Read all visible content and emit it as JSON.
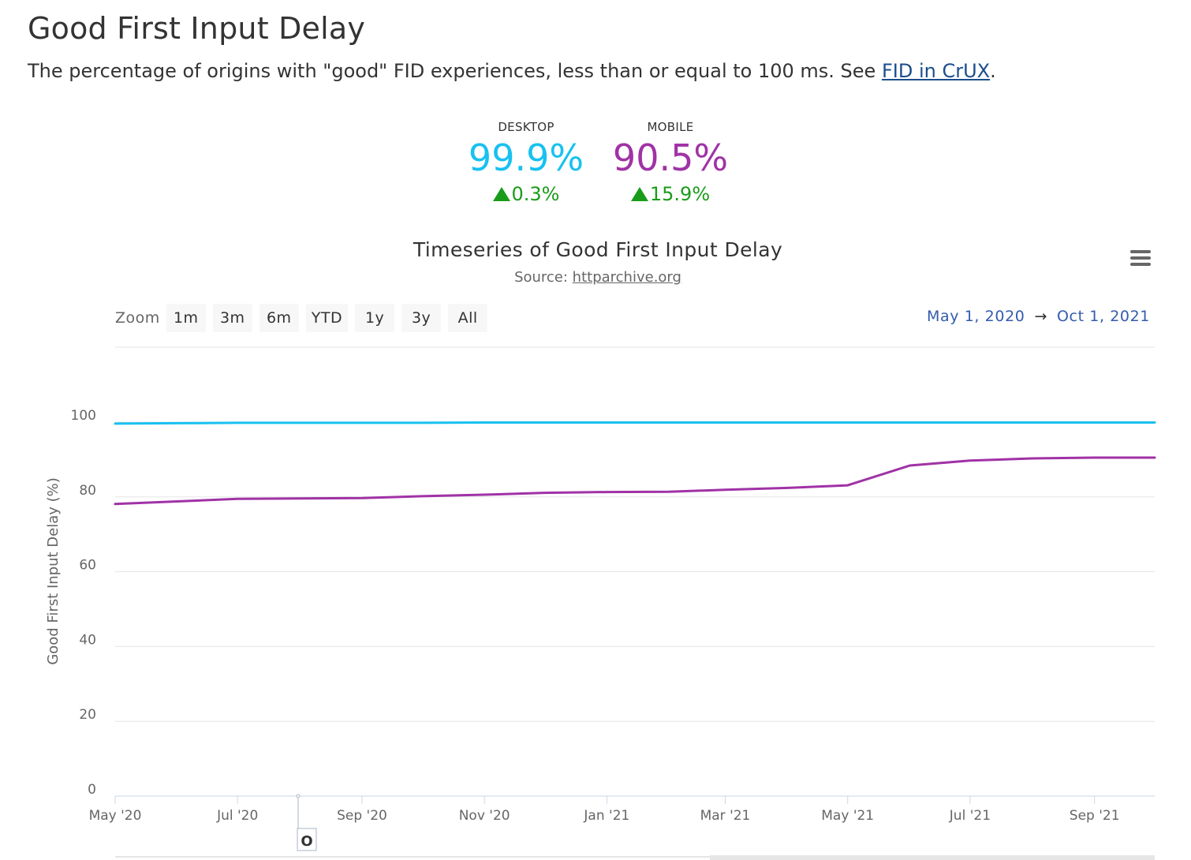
{
  "header": {
    "title": "Good First Input Delay",
    "description_prefix": "The percentage of origins with \"good\" FID experiences, less than or equal to 100 ms. See ",
    "description_link": "FID in CrUX",
    "description_suffix": "."
  },
  "kpis": {
    "desktop": {
      "label": "DESKTOP",
      "value": "99.9%",
      "change": "0.3%",
      "color": "#18c1f0"
    },
    "mobile": {
      "label": "MOBILE",
      "value": "90.5%",
      "change": "15.9%",
      "color": "#a032a6"
    }
  },
  "chart": {
    "title": "Timeseries of Good First Input Delay",
    "subtitle_prefix": "Source: ",
    "subtitle_link": "httparchive.org",
    "menu_icon": "hamburger-menu-icon",
    "zoom": {
      "label": "Zoom",
      "buttons": [
        "1m",
        "3m",
        "6m",
        "YTD",
        "1y",
        "3y",
        "All"
      ]
    },
    "range": {
      "from": "May 1, 2020",
      "arrow": "→",
      "to": "Oct 1, 2021"
    },
    "navigator_handle_label": "O"
  },
  "chart_data": {
    "type": "line",
    "title": "Timeseries of Good First Input Delay",
    "xlabel": "",
    "ylabel": "Good First Input Delay (%)",
    "ylim": [
      0,
      100
    ],
    "yticks": [
      0,
      20,
      40,
      60,
      80,
      100
    ],
    "xlim": [
      "2020-05-01",
      "2021-10-01"
    ],
    "xticks": [
      {
        "date": "2020-05-01",
        "label": "May '20"
      },
      {
        "date": "2020-07-01",
        "label": "Jul '20"
      },
      {
        "date": "2020-09-01",
        "label": "Sep '20"
      },
      {
        "date": "2020-11-01",
        "label": "Nov '20"
      },
      {
        "date": "2021-01-01",
        "label": "Jan '21"
      },
      {
        "date": "2021-03-01",
        "label": "Mar '21"
      },
      {
        "date": "2021-05-01",
        "label": "May '21"
      },
      {
        "date": "2021-07-01",
        "label": "Jul '21"
      },
      {
        "date": "2021-09-01",
        "label": "Sep '21"
      }
    ],
    "grid": true,
    "x": [
      "2020-05-01",
      "2020-06-01",
      "2020-07-01",
      "2020-08-01",
      "2020-09-01",
      "2020-10-01",
      "2020-11-01",
      "2020-12-01",
      "2021-01-01",
      "2021-02-01",
      "2021-03-01",
      "2021-04-01",
      "2021-05-01",
      "2021-06-01",
      "2021-07-01",
      "2021-08-01",
      "2021-09-01",
      "2021-10-01"
    ],
    "series": [
      {
        "name": "DESKTOP",
        "color": "#18c1f0",
        "values": [
          99.6,
          99.7,
          99.8,
          99.8,
          99.8,
          99.8,
          99.9,
          99.9,
          99.9,
          99.9,
          99.9,
          99.9,
          99.9,
          99.9,
          99.9,
          99.9,
          99.9,
          99.9
        ]
      },
      {
        "name": "MOBILE",
        "color": "#a032a6",
        "values": [
          78.1,
          78.8,
          79.5,
          79.6,
          79.7,
          80.2,
          80.6,
          81.1,
          81.3,
          81.4,
          81.9,
          82.4,
          83.1,
          88.4,
          89.7,
          90.3,
          90.5,
          90.5
        ]
      }
    ]
  }
}
